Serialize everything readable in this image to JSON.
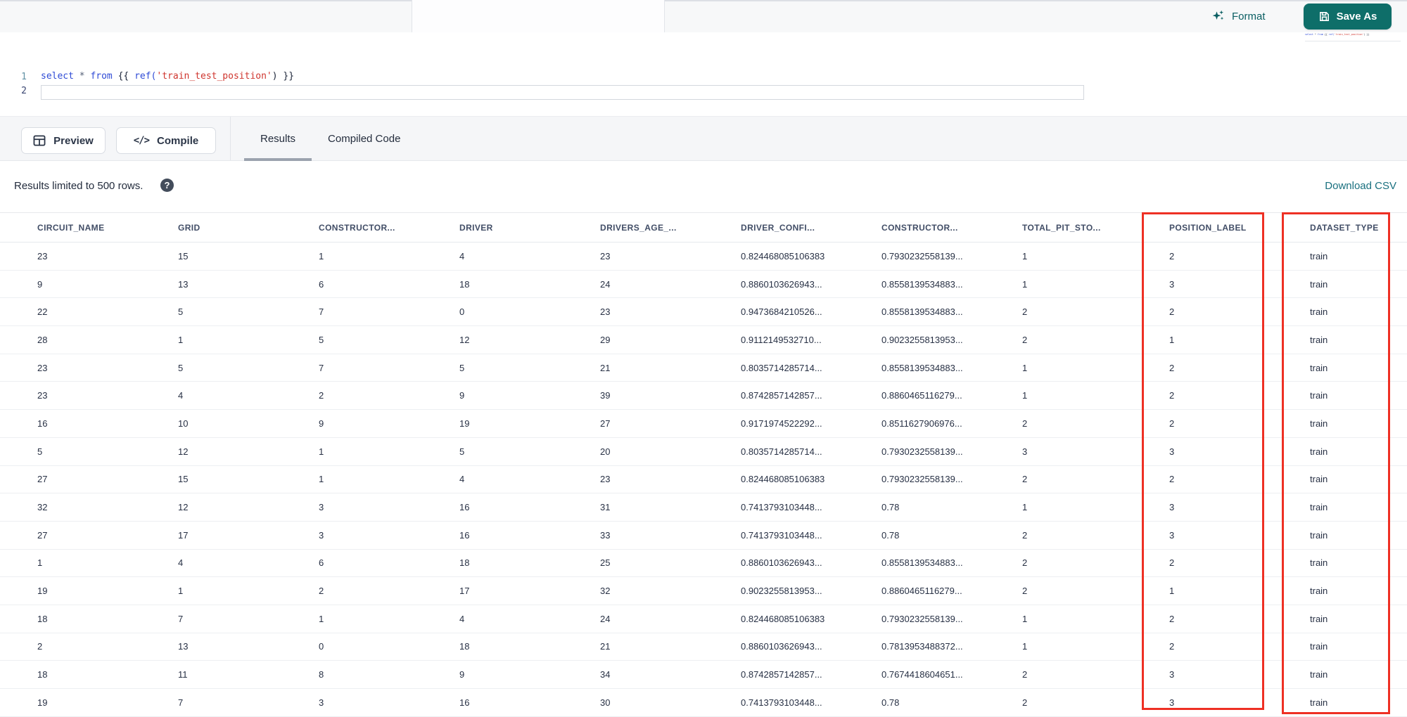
{
  "header": {
    "format_label": "Format",
    "save_as_label": "Save As"
  },
  "editor": {
    "line_numbers": [
      "1",
      "2"
    ],
    "code_text": "select * from {{ ref('train_test_position') }}",
    "tokens": [
      [
        "kw",
        "select"
      ],
      [
        "pl",
        " "
      ],
      [
        "op",
        "*"
      ],
      [
        "pl",
        " "
      ],
      [
        "kw",
        "from"
      ],
      [
        "pl",
        " "
      ],
      [
        "br",
        "{{"
      ],
      [
        "pl",
        " "
      ],
      [
        "fn",
        "ref("
      ],
      [
        "str",
        "'train_test_position'"
      ],
      [
        "br",
        ")"
      ],
      [
        "pl",
        " "
      ],
      [
        "br",
        "}}"
      ]
    ]
  },
  "toolbar": {
    "preview_label": "Preview",
    "compile_label": "Compile",
    "compile_glyph": "</>",
    "tabs": [
      {
        "label": "Results",
        "active": true
      },
      {
        "label": "Compiled Code",
        "active": false
      }
    ]
  },
  "results_bar": {
    "limit_text": "Results limited to 500 rows.",
    "help_glyph": "?",
    "download_label": "Download CSV"
  },
  "table": {
    "columns": [
      "CIRCUIT_NAME",
      "GRID",
      "CONSTRUCTOR...",
      "DRIVER",
      "DRIVERS_AGE_...",
      "DRIVER_CONFI...",
      "CONSTRUCTOR...",
      "TOTAL_PIT_STO...",
      "POSITION_LABEL",
      "DATASET_TYPE"
    ],
    "highlighted_columns": [
      "POSITION_LABEL",
      "DATASET_TYPE"
    ],
    "highlight_color": "#ee3024",
    "rows": [
      [
        "23",
        "15",
        "1",
        "4",
        "23",
        "0.824468085106383",
        "0.7930232558139...",
        "1",
        "2",
        "train"
      ],
      [
        "9",
        "13",
        "6",
        "18",
        "24",
        "0.8860103626943...",
        "0.8558139534883...",
        "1",
        "3",
        "train"
      ],
      [
        "22",
        "5",
        "7",
        "0",
        "23",
        "0.9473684210526...",
        "0.8558139534883...",
        "2",
        "2",
        "train"
      ],
      [
        "28",
        "1",
        "5",
        "12",
        "29",
        "0.9112149532710...",
        "0.9023255813953...",
        "2",
        "1",
        "train"
      ],
      [
        "23",
        "5",
        "7",
        "5",
        "21",
        "0.8035714285714...",
        "0.8558139534883...",
        "1",
        "2",
        "train"
      ],
      [
        "23",
        "4",
        "2",
        "9",
        "39",
        "0.8742857142857...",
        "0.8860465116279...",
        "1",
        "2",
        "train"
      ],
      [
        "16",
        "10",
        "9",
        "19",
        "27",
        "0.9171974522292...",
        "0.8511627906976...",
        "2",
        "2",
        "train"
      ],
      [
        "5",
        "12",
        "1",
        "5",
        "20",
        "0.8035714285714...",
        "0.7930232558139...",
        "3",
        "3",
        "train"
      ],
      [
        "27",
        "15",
        "1",
        "4",
        "23",
        "0.824468085106383",
        "0.7930232558139...",
        "2",
        "2",
        "train"
      ],
      [
        "32",
        "12",
        "3",
        "16",
        "31",
        "0.7413793103448...",
        "0.78",
        "1",
        "3",
        "train"
      ],
      [
        "27",
        "17",
        "3",
        "16",
        "33",
        "0.7413793103448...",
        "0.78",
        "2",
        "3",
        "train"
      ],
      [
        "1",
        "4",
        "6",
        "18",
        "25",
        "0.8860103626943...",
        "0.8558139534883...",
        "2",
        "2",
        "train"
      ],
      [
        "19",
        "1",
        "2",
        "17",
        "32",
        "0.9023255813953...",
        "0.8860465116279...",
        "2",
        "1",
        "train"
      ],
      [
        "18",
        "7",
        "1",
        "4",
        "24",
        "0.824468085106383",
        "0.7930232558139...",
        "1",
        "2",
        "train"
      ],
      [
        "2",
        "13",
        "0",
        "18",
        "21",
        "0.8860103626943...",
        "0.7813953488372...",
        "1",
        "2",
        "train"
      ],
      [
        "18",
        "11",
        "8",
        "9",
        "34",
        "0.8742857142857...",
        "0.7674418604651...",
        "2",
        "3",
        "train"
      ],
      [
        "19",
        "7",
        "3",
        "16",
        "30",
        "0.7413793103448...",
        "0.78",
        "2",
        "3",
        "train"
      ]
    ]
  },
  "colors": {
    "accent_teal": "#0e6e69",
    "link_teal": "#19707f",
    "annotation_red": "#ee3024"
  }
}
